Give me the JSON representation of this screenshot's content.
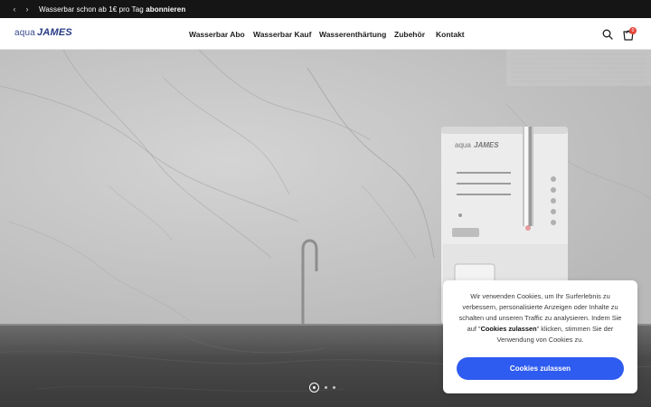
{
  "announcement": {
    "text": "Wasserbar schon ab 1€ pro Tag",
    "link": "abonnieren"
  },
  "header": {
    "logo_part1": "aqua",
    "logo_part2": "JAMES",
    "nav": [
      {
        "label": "Wasserbar Abo"
      },
      {
        "label": "Wasserbar Kauf"
      },
      {
        "label": "Wasserenthärtung"
      },
      {
        "label": "Zubehör"
      },
      {
        "label": "Kontakt"
      }
    ],
    "cart_count": "0"
  },
  "hero": {
    "device_logo_part1": "aqua",
    "device_logo_part2": "JAMES"
  },
  "cookie": {
    "text_before": "Wir verwenden Cookies, um Ihr Surferlebnis zu verbessern, personalisierte Anzeigen oder Inhalte zu schalten und unseren Traffic zu analysieren. Indem Sie auf \"",
    "text_bold": "Cookies zulassen",
    "text_after": "\" klicken, stimmen Sie der Verwendung von Cookies zu.",
    "button_label": "Cookies zulassen"
  },
  "colors": {
    "accent": "#2e5bf0",
    "brand": "#273a84",
    "badge": "#e4473b"
  }
}
